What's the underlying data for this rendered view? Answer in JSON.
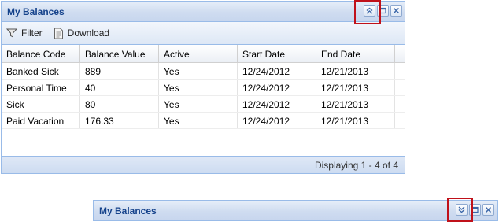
{
  "main_panel": {
    "title": "My Balances",
    "tools": [
      "collapse-up-icon",
      "maximize-icon",
      "close-icon"
    ]
  },
  "toolbar": {
    "filter_label": "Filter",
    "download_label": "Download"
  },
  "grid": {
    "columns": [
      "Balance Code",
      "Balance Value",
      "Active",
      "Start Date",
      "End Date"
    ],
    "rows": [
      [
        "Banked Sick",
        "889",
        "Yes",
        "12/24/2012",
        "12/21/2013"
      ],
      [
        "Personal Time",
        "40",
        "Yes",
        "12/24/2012",
        "12/21/2013"
      ],
      [
        "Sick",
        "80",
        "Yes",
        "12/24/2012",
        "12/21/2013"
      ],
      [
        "Paid Vacation",
        "176.33",
        "Yes",
        "12/24/2012",
        "12/21/2013"
      ]
    ]
  },
  "footer": {
    "paging_text": "Displaying 1 - 4 of 4"
  },
  "collapsed_panel": {
    "title": "My Balances",
    "tools": [
      "expand-down-icon",
      "maximize-icon",
      "close-icon"
    ]
  },
  "colors": {
    "header_title": "#15428b",
    "panel_border": "#99bbe8",
    "highlight": "#c0111a"
  }
}
